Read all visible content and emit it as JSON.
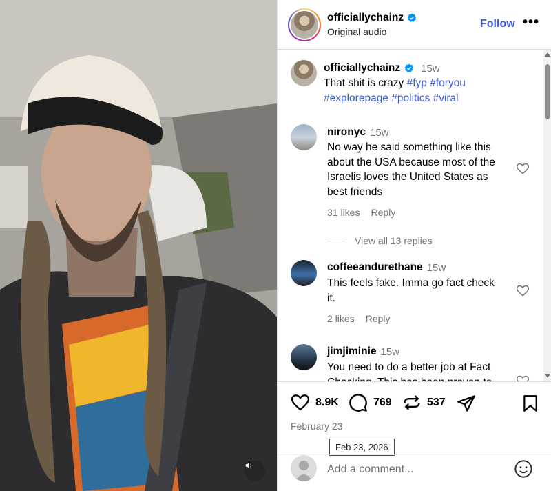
{
  "post": {
    "username": "officiallychainz",
    "audio": "Original audio",
    "follow_label": "Follow",
    "more_label": "•••",
    "verified_color": "#0095f6",
    "link_color": "#3d5bd6"
  },
  "caption": {
    "username": "officiallychainz",
    "time": "15w",
    "text": "That shit is crazy",
    "hashtags": [
      "#fyp",
      "#foryou",
      "#explorepage",
      "#politics",
      "#viral"
    ]
  },
  "comments": [
    {
      "username": "nironyc",
      "time": "15w",
      "lines": [
        "No way he said something like this",
        "about the USA because most of the",
        "Israelis loves the United States as",
        "best friends"
      ],
      "likes": "31 likes",
      "reply_label": "Reply",
      "replies_label": "View all 13 replies"
    },
    {
      "username": "coffeeandurethane",
      "time": "15w",
      "lines": [
        "This feels fake. Imma go fact check",
        "it."
      ],
      "likes": "2 likes",
      "reply_label": "Reply"
    },
    {
      "username": "jimjiminie",
      "time": "15w",
      "lines": [
        "You need to do a better job at Fact",
        "Checking. This has been proven to"
      ]
    }
  ],
  "actions": {
    "like_count": "8.9K",
    "comment_count": "769",
    "repost_count": "537"
  },
  "date": "February 23",
  "date_tooltip": "Feb 23, 2026",
  "add_comment": {
    "placeholder": "Add a comment..."
  },
  "icons": {
    "like": "heart-icon",
    "comment": "comment-icon",
    "repost": "repost-icon",
    "share": "paper-plane-icon",
    "save": "bookmark-icon",
    "emoji": "smiley-icon",
    "mute": "speaker-icon",
    "more": "more-icon"
  }
}
